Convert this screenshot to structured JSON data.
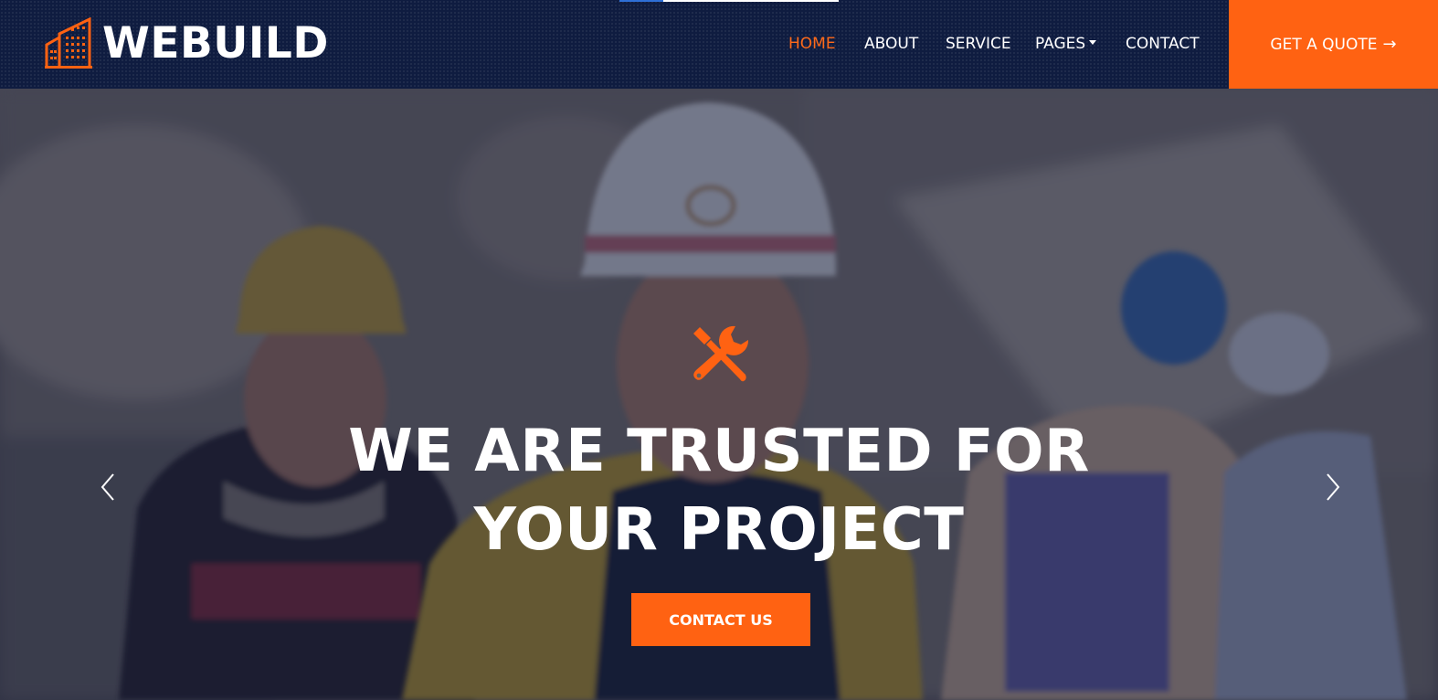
{
  "brand": {
    "name": "WEBUILD",
    "icon": "building-icon",
    "accent_color": "#ff6212",
    "navbar_color": "#0f1c40"
  },
  "nav": {
    "items": [
      {
        "label": "HOME",
        "active": true
      },
      {
        "label": "ABOUT",
        "active": false
      },
      {
        "label": "SERVICE",
        "active": false
      },
      {
        "label": "PAGES",
        "active": false,
        "has_dropdown": true
      },
      {
        "label": "CONTACT",
        "active": false
      }
    ],
    "quote_button": {
      "label": "GET A QUOTE",
      "icon": "arrow-right-icon"
    }
  },
  "hero": {
    "icon": "tools-icon",
    "heading_line1": "WE ARE TRUSTED FOR",
    "heading_line2": "YOUR PROJECT",
    "cta_label": "CONTACT US",
    "prev_icon": "chevron-left-icon",
    "next_icon": "chevron-right-icon"
  }
}
